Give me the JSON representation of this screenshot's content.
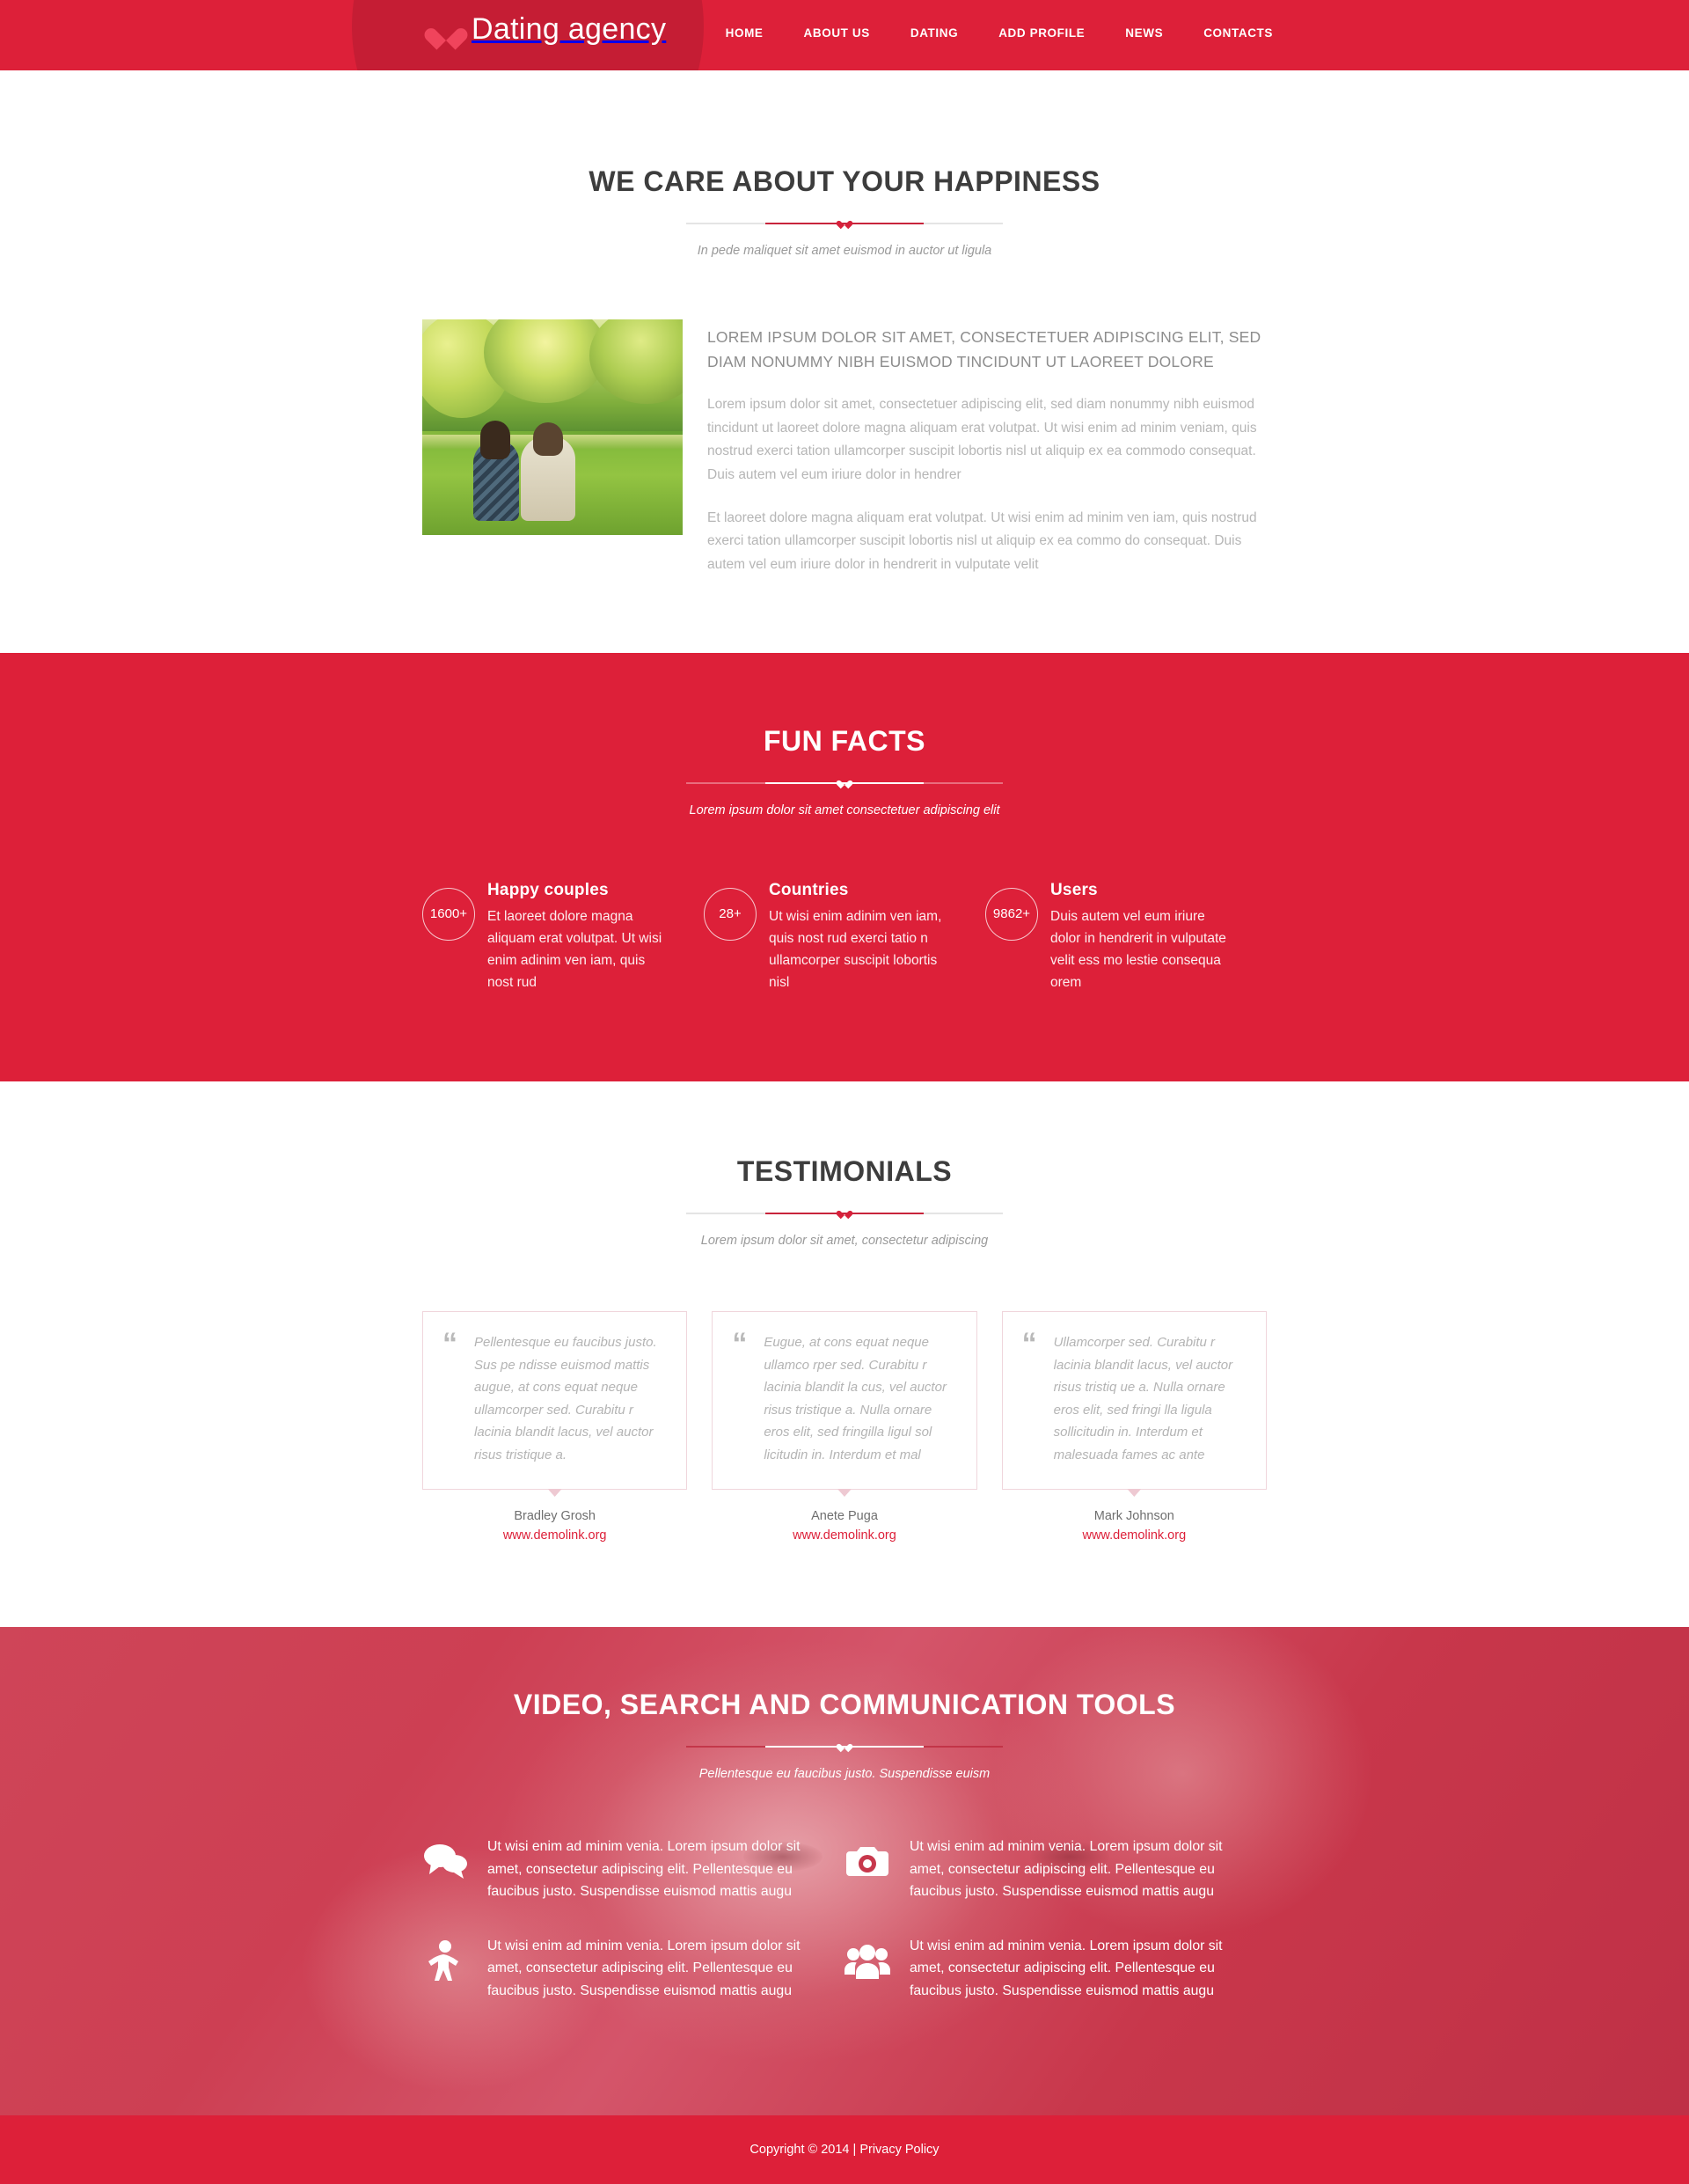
{
  "header": {
    "logo_text": "Dating agency",
    "logo_icon": "heart-icon",
    "nav": [
      {
        "label": "HOME"
      },
      {
        "label": "ABOUT US"
      },
      {
        "label": "DATING"
      },
      {
        "label": "ADD PROFILE"
      },
      {
        "label": "NEWS"
      },
      {
        "label": "CONTACTS"
      }
    ]
  },
  "about": {
    "title": "WE CARE ABOUT YOUR HAPPINESS",
    "subtitle": "In pede maliquet sit amet euismod in auctor ut ligula",
    "image_alt": "couple-sitting-in-park-photo",
    "heading": "LOREM IPSUM DOLOR SIT AMET, CONSECTETUER ADIPISCING ELIT, SED DIAM NONUMMY NIBH EUISMOD TINCIDUNT UT LAOREET DOLORE",
    "paragraph1": "Lorem ipsum dolor sit amet, consectetuer adipiscing elit, sed diam nonummy nibh euismod tincidunt ut laoreet dolore magna aliquam erat volutpat. Ut wisi enim ad minim veniam, quis nostrud exerci tation ullamcorper suscipit lobortis nisl ut aliquip ex ea commodo consequat. Duis autem vel eum iriure dolor in hendrer",
    "paragraph2": "Et laoreet dolore magna aliquam erat volutpat. Ut wisi enim ad minim ven iam, quis nostrud exerci tation ullamcorper suscipit lobortis nisl ut aliquip ex ea commo do consequat. Duis autem vel eum iriure dolor in hendrerit in vulputate velit"
  },
  "funfacts": {
    "title": "FUN FACTS",
    "subtitle": "Lorem ipsum dolor sit amet consectetuer adipiscing elit",
    "items": [
      {
        "count": "1600+",
        "title": "Happy couples",
        "text": "Et laoreet dolore magna aliquam erat volutpat. Ut wisi enim adinim ven iam, quis nost rud"
      },
      {
        "count": "28+",
        "title": "Countries",
        "text": "Ut wisi enim adinim  ven iam, quis nost rud exerci tatio n ullamcorper suscipit lobortis nisl"
      },
      {
        "count": "9862+",
        "title": "Users",
        "text": "Duis autem vel eum iriure dolor in hendrerit in vulputate velit ess mo lestie consequa orem"
      }
    ]
  },
  "testimonials": {
    "title": "TESTIMONIALS",
    "subtitle": "Lorem ipsum dolor sit amet, consectetur adipiscing",
    "items": [
      {
        "quote": "Pellentesque eu faucibus justo. Sus pe ndisse euismod mattis augue, at cons equat neque ullamcorper sed. Curabitu r lacinia blandit lacus, vel auctor risus tristique a.",
        "name": "Bradley Grosh",
        "link": "www.demolink.org"
      },
      {
        "quote": "Eugue, at cons equat neque ullamco rper sed. Curabitu r lacinia blandit la cus, vel auctor risus tristique a. Nulla ornare eros elit, sed fringilla ligul sol licitudin in. Interdum et mal",
        "name": "Anete Puga",
        "link": "www.demolink.org"
      },
      {
        "quote": "Ullamcorper sed. Curabitu r lacinia blandit lacus, vel auctor risus tristiq ue a. Nulla ornare eros elit, sed fringi lla ligula sollicitudin in. Interdum et malesuada fames ac ante",
        "name": "Mark Johnson",
        "link": "www.demolink.org"
      }
    ]
  },
  "tools": {
    "title": "VIDEO, SEARCH AND COMMUNICATION TOOLS",
    "subtitle": "Pellentesque eu faucibus justo. Suspendisse euism",
    "items": [
      {
        "icon": "chat-bubbles-icon",
        "text": "Ut wisi enim ad minim venia. Lorem ipsum dolor sit amet, consectetur adipiscing elit. Pellentesque eu faucibus justo. Suspendisse euismod mattis augu"
      },
      {
        "icon": "camera-icon",
        "text": "Ut wisi enim ad minim venia. Lorem ipsum dolor sit amet, consectetur adipiscing elit. Pellentesque eu faucibus justo. Suspendisse euismod mattis augu"
      },
      {
        "icon": "person-icon",
        "text": "Ut wisi enim ad minim venia. Lorem ipsum dolor sit amet, consectetur adipiscing elit. Pellentesque eu faucibus justo. Suspendisse euismod mattis augu"
      },
      {
        "icon": "group-users-icon",
        "text": "Ut wisi enim ad minim venia. Lorem ipsum dolor sit amet, consectetur adipiscing elit. Pellentesque eu faucibus justo. Suspendisse euismod mattis augu"
      }
    ]
  },
  "footer": {
    "copyright": "Copyright © 2014 | ",
    "privacy_label": "Privacy Policy"
  },
  "colors": {
    "brand_red": "#dd2039",
    "brand_dark_red": "#c51d34",
    "link_red": "#dd2039",
    "heading_gray": "#3d3d3d",
    "body_gray": "#b6b6b6"
  }
}
